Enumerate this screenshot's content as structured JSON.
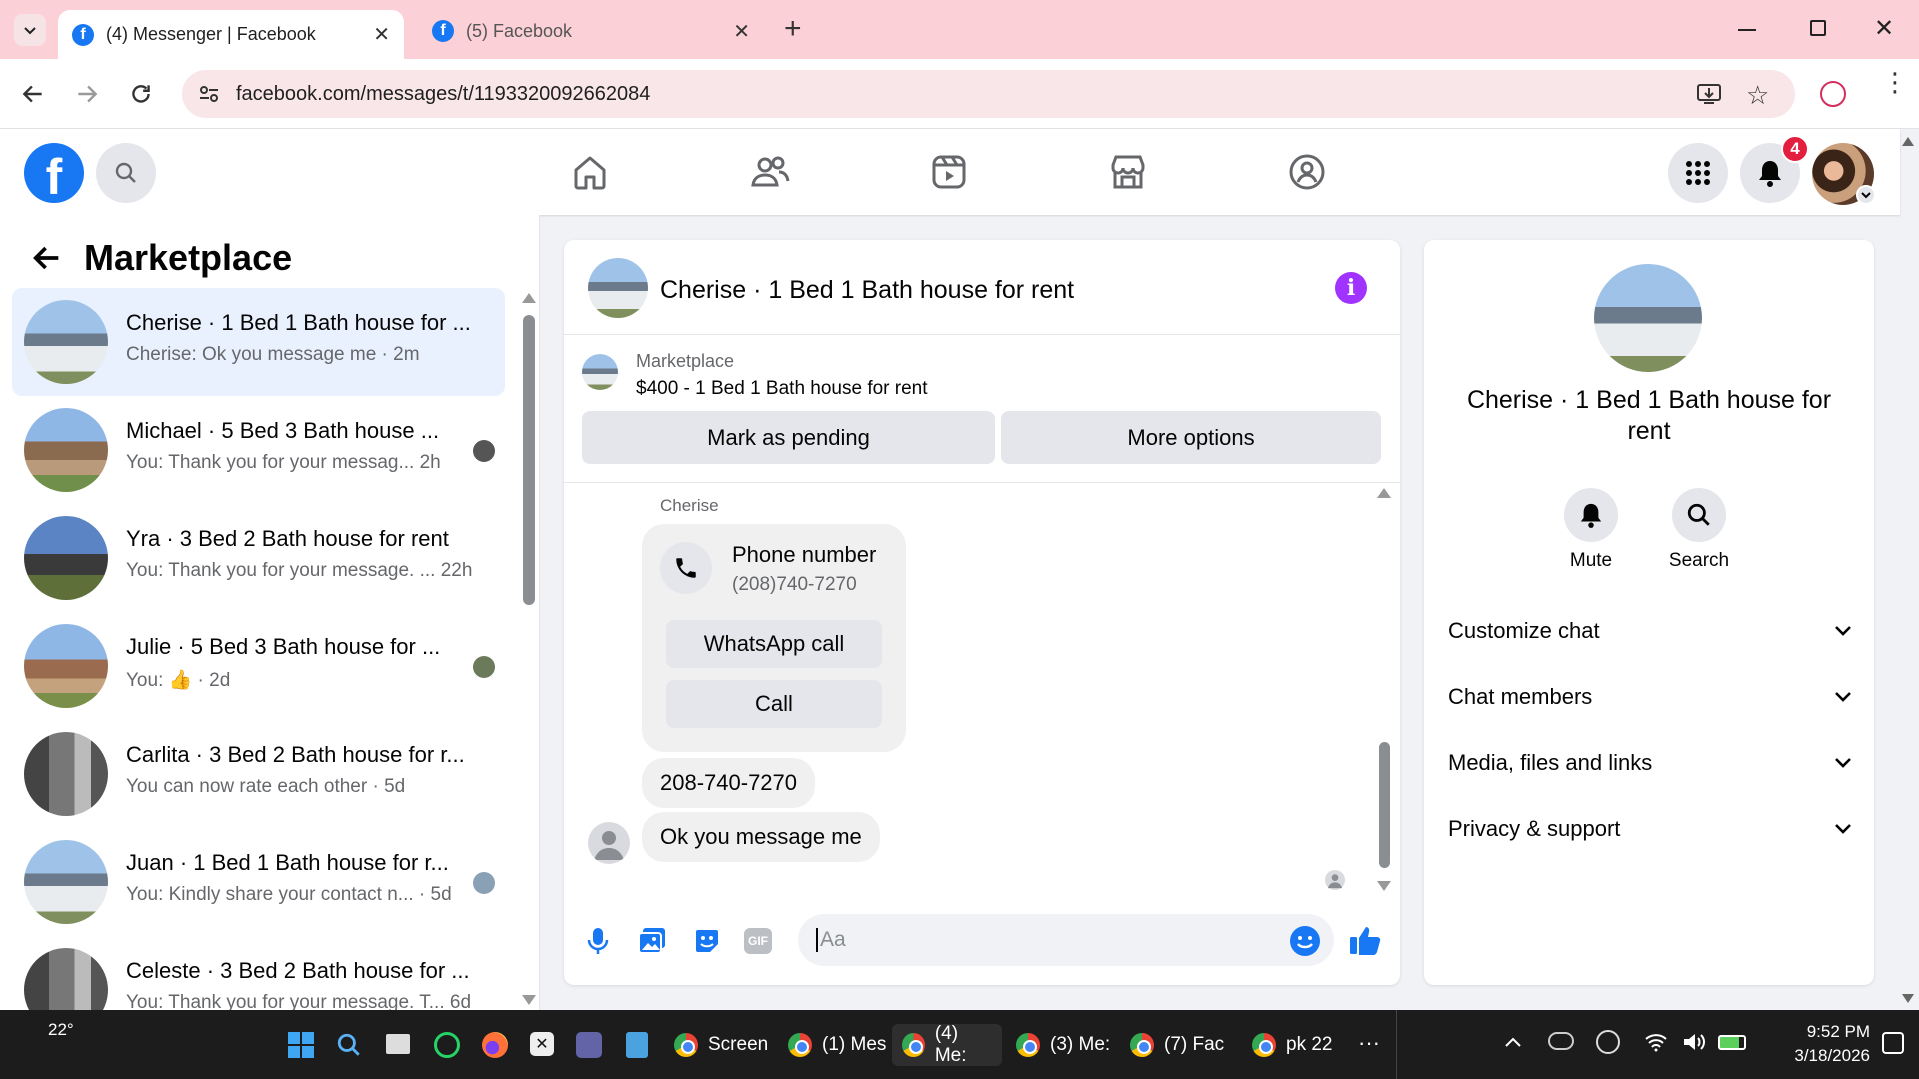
{
  "browser": {
    "tabs": [
      {
        "title": "(4) Messenger | Facebook",
        "active": true
      },
      {
        "title": "(5) Facebook",
        "active": false
      }
    ],
    "new_tab": "+",
    "url": "facebook.com/messages/t/1193320092662084"
  },
  "fbnav": {
    "logo": "f",
    "notification_count": "4"
  },
  "sidebar": {
    "title": "Marketplace",
    "chats": [
      {
        "title": "Cherise · 1 Bed 1 Bath house for ...",
        "preview": "Cherise: Ok you message me · 2m",
        "selected": true
      },
      {
        "title": "Michael · 5 Bed 3 Bath house ...",
        "preview": "You: Thank you for your messag...   2h"
      },
      {
        "title": "Yra · 3 Bed 2 Bath house for rent",
        "preview": "You: Thank you for your message. ...  22h"
      },
      {
        "title": "Julie · 5 Bed 3 Bath house for ...",
        "preview": "You: 👍 · 2d"
      },
      {
        "title": "Carlita · 3 Bed 2 Bath house for r...",
        "preview": "You can now rate each other · 5d"
      },
      {
        "title": "Juan · 1 Bed 1 Bath house for r...",
        "preview": "You: Kindly share your contact n...  · 5d"
      },
      {
        "title": "Celeste · 3 Bed 2 Bath house for ...",
        "preview": "You: Thank you for your message. T...  6d"
      }
    ]
  },
  "conversation": {
    "header_title": "Cherise · 1 Bed 1 Bath house for rent",
    "listing_label": "Marketplace",
    "listing_text": "$400 - 1 Bed 1 Bath house for rent",
    "mark_pending": "Mark as pending",
    "more_options": "More options",
    "sender_name": "Cherise",
    "contact_card": {
      "title": "Phone number",
      "number": "(208)740-7270",
      "whatsapp": "WhatsApp call",
      "call": "Call"
    },
    "messages": [
      "208-740-7270",
      "Ok you message me"
    ],
    "composer_placeholder": "Aa"
  },
  "info_panel": {
    "name": "Cherise · 1 Bed 1 Bath house for rent",
    "mute": "Mute",
    "search": "Search",
    "sections": [
      "Customize chat",
      "Chat members",
      "Media, files and links",
      "Privacy & support"
    ]
  },
  "taskbar": {
    "weather": "22°",
    "apps": [
      "Screen",
      "(1) Mes",
      "(4) Me:",
      "(3) Me:",
      "(7) Fac",
      "pk 22"
    ],
    "time": "9:52 PM",
    "date": "3/18/2026"
  },
  "colors": {
    "fb_blue": "#1877f2",
    "messenger_purple": "#a033ff",
    "selected_row": "#e8f1fd",
    "tabbar_pink": "#fbd0d6"
  }
}
